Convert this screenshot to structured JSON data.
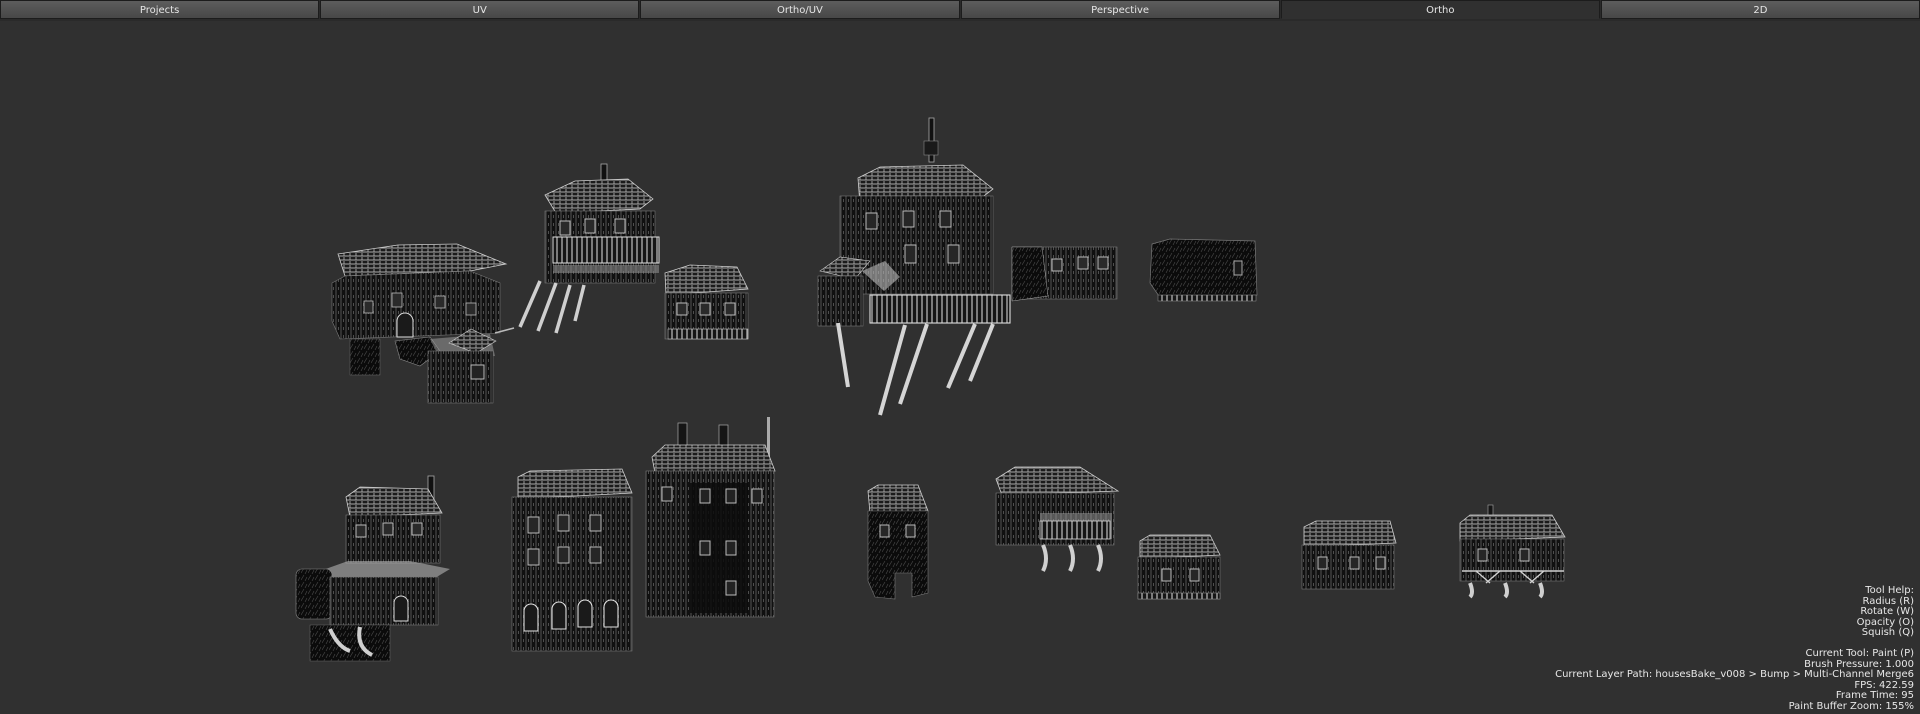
{
  "tabs": [
    "Projects",
    "UV",
    "Ortho/UV",
    "Perspective",
    "Ortho",
    "2D"
  ],
  "active_tab": "Ortho",
  "hud": {
    "tool_help_label": "Tool Help:",
    "tool_help_items": [
      "Radius (R)",
      "Rotate (W)",
      "Opacity (O)",
      "Squish (Q)"
    ],
    "current_tool": "Current Tool: Paint (P)",
    "brush_pressure": "Brush Pressure: 1.000",
    "layer_path": "Current Layer Path: housesBake_v008 > Bump > Multi-Channel Merge6",
    "fps": "FPS: 422.59",
    "frame_time": "Frame Time: 95",
    "paint_buffer_zoom": "Paint Buffer Zoom: 155%"
  },
  "colors": {
    "background": "#303030",
    "tab_fill": "#525252",
    "text": "#e6e6e6"
  }
}
